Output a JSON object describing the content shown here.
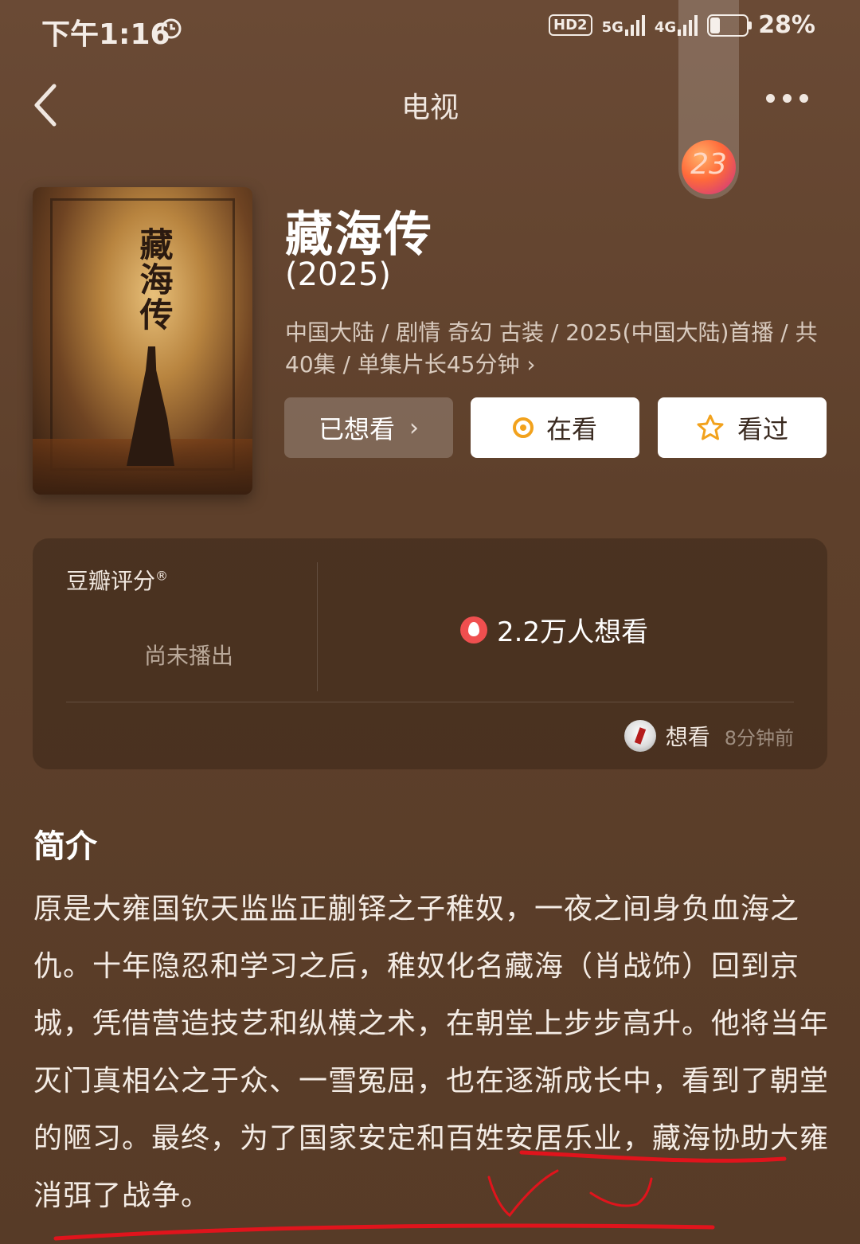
{
  "status_bar": {
    "time": "下午1:16",
    "hd": "HD2",
    "net1": "5G",
    "net2": "4G",
    "battery": "28%",
    "battery_level": 0.28
  },
  "nav": {
    "title": "电视",
    "floater_label": "23"
  },
  "show": {
    "title": "藏海传",
    "year": "(2025)",
    "meta": "中国大陆 / 剧情 奇幻 古装 / 2025(中国大陆)首播 / 共40集 / 单集片长45分钟 ›",
    "poster_title": "藏海传"
  },
  "actions": {
    "want": "已想看",
    "watching": "在看",
    "watched": "看过"
  },
  "rating": {
    "label": "豆瓣评分",
    "label_mark": "®",
    "value": "尚未播出",
    "wish_count": "2.2万人想看",
    "activity_action": "想看",
    "activity_time": "8分钟前"
  },
  "synopsis": {
    "title": "简介",
    "text": "原是大雍国钦天监监正蒯铎之子稚奴，一夜之间身负血海之仇。十年隐忍和学习之后，稚奴化名藏海（肖战饰）回到京城，凭借营造技艺和纵横之术，在朝堂上步步高升。他将当年灭门真相公之于众、一雪冤屈，也在逐渐成长中，看到了朝堂的陋习。最终，为了国家安定和百姓安居乐业，藏海协助大雍消弭了战争。"
  },
  "colors": {
    "background": "#5e402b",
    "accent": "#f2a21d",
    "annotation": "#e0141c"
  }
}
